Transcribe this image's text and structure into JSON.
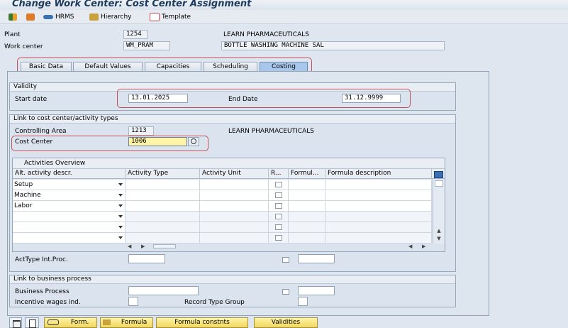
{
  "window": {
    "title": "Change Work Center: Cost Center Assignment"
  },
  "toolbar": {
    "hrms": "HRMS",
    "hierarchy": "Hierarchy",
    "template": "Template"
  },
  "header": {
    "plant_label": "Plant",
    "plant_value": "1254",
    "plant_desc": "LEARN PHARMACEUTICALS",
    "work_center_label": "Work center",
    "work_center_value": "WM_PRAM",
    "work_center_desc": "BOTTLE WASHING MACHINE SAL"
  },
  "tabs": [
    "Basic Data",
    "Default Values",
    "Capacities",
    "Scheduling",
    "Costing"
  ],
  "active_tab": "Costing",
  "validity": {
    "heading": "Validity",
    "start_label": "Start date",
    "start_value": "13.01.2025",
    "end_label": "End Date",
    "end_value": "31.12.9999"
  },
  "cost_center_link": {
    "heading": "Link to cost center/activity types",
    "controlling_area_label": "Controlling Area",
    "controlling_area_value": "1213",
    "controlling_area_desc": "LEARN PHARMACEUTICALS",
    "cost_center_label": "Cost Center",
    "cost_center_value": "1006"
  },
  "activities": {
    "heading": "Activities Overview",
    "columns": [
      "Alt. activity descr.",
      "Activity Type",
      "Activity Unit",
      "R...",
      "Formul...",
      "Formula description"
    ],
    "rows": [
      {
        "desc": "Setup"
      },
      {
        "desc": "Machine"
      },
      {
        "desc": "Labor"
      },
      {
        "desc": ""
      },
      {
        "desc": ""
      },
      {
        "desc": ""
      }
    ],
    "acttype_label": "ActType Int.Proc."
  },
  "business_process": {
    "heading": "Link to business process",
    "business_process_label": "Business Process",
    "incentive_label": "Incentive wages ind.",
    "record_type_label": "Record Type Group"
  },
  "bottom_buttons": {
    "form": "Form.",
    "formula": "Formula",
    "formula_constants": "Formula constnts",
    "validities": "Validities"
  },
  "colors": {
    "accent": "#a9c7ea",
    "highlight": "#c0505a",
    "required": "#fff4a8",
    "button": "#f1d75e"
  }
}
